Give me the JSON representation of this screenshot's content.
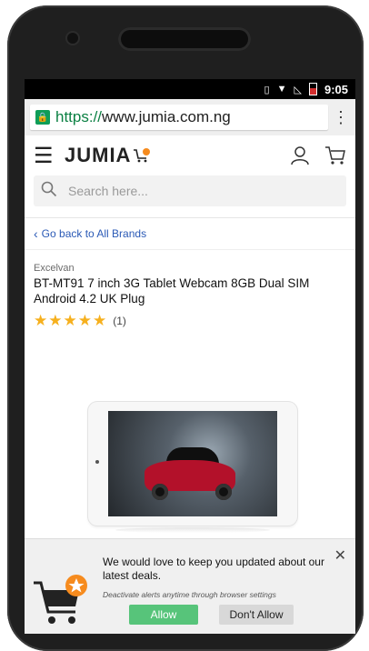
{
  "status_bar": {
    "time": "9:05",
    "icons": [
      "vibrate-icon",
      "wifi-icon",
      "no-signal-icon",
      "battery-low-icon"
    ]
  },
  "browser": {
    "url_scheme": "https://",
    "url_rest": "www.jumia.com.ng",
    "lock_icon": "lock-icon",
    "menu_icon": "overflow-menu-icon"
  },
  "header": {
    "logo_text": "JUMIA",
    "icons": [
      "hamburger-icon",
      "user-icon",
      "cart-icon"
    ],
    "brand_color": "#f68b1e"
  },
  "search": {
    "placeholder": "Search here..."
  },
  "back_link": {
    "label": "Go back to All Brands"
  },
  "product": {
    "brand": "Excelvan",
    "title": "BT-MT91 7 inch 3G Tablet Webcam 8GB Dual SIM Android 4.2 UK Plug",
    "rating_stars": 5,
    "rating_text": "★★★★★",
    "rating_count": "(1)"
  },
  "notification": {
    "message": "We would love to keep you updated about our latest deals.",
    "subtext": "Deactivate alerts anytime through browser settings",
    "allow_label": "Allow",
    "deny_label": "Don't Allow",
    "allow_color": "#57c47a"
  }
}
